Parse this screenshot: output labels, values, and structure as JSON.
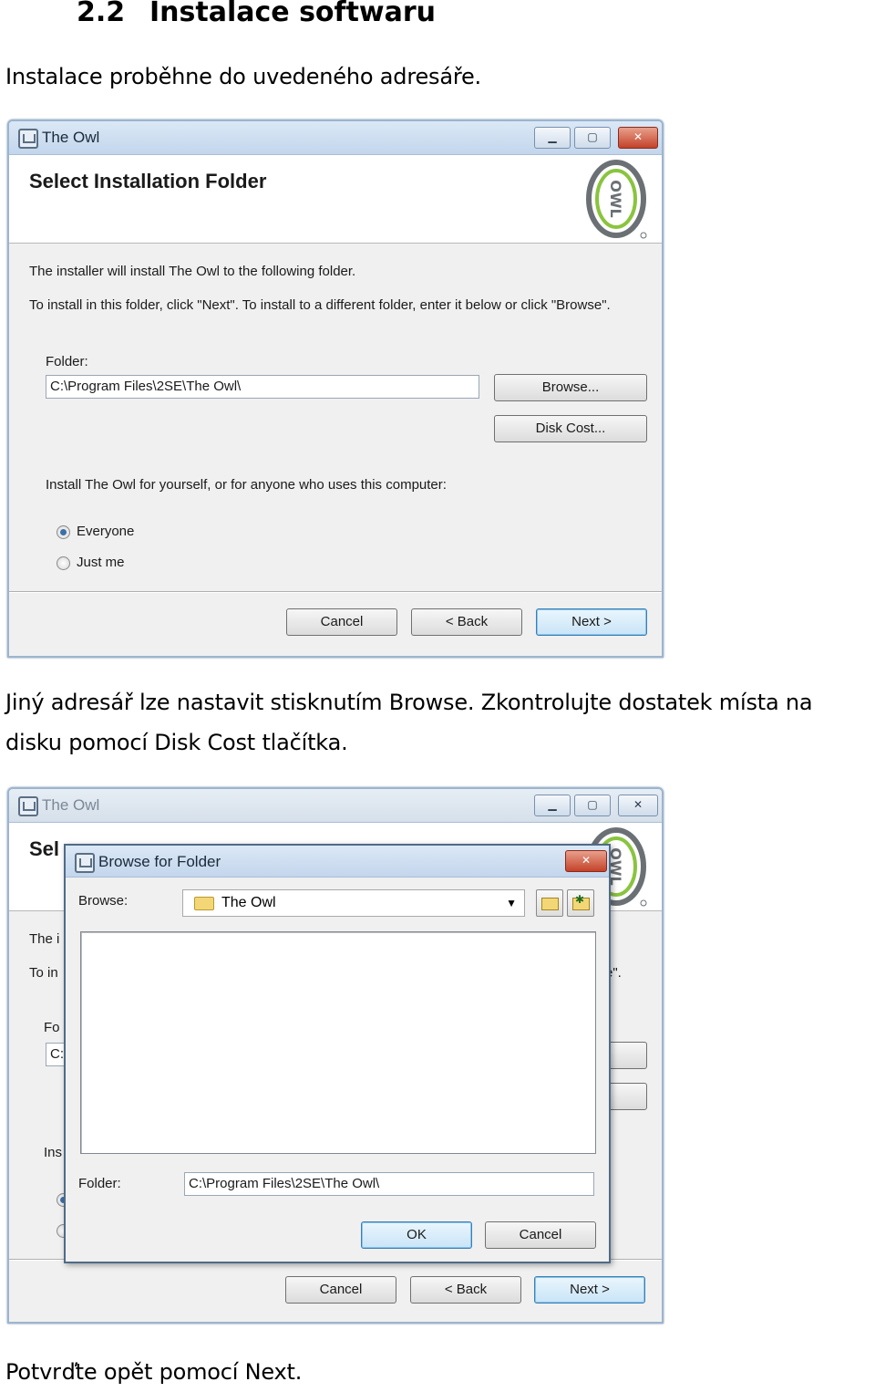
{
  "doc": {
    "heading_number": "2.2",
    "heading_text": "Instalace softwaru",
    "para1": "Instalace proběhne do uvedeného adresáře.",
    "para2_line1": "Jiný adresář lze nastavit stisknutím Browse. Zkontrolujte dostatek místa na",
    "para2_line2": "disku pomocí Disk Cost tlačítka.",
    "para3": "Potvrďte opět pomocí Next."
  },
  "installer": {
    "window_title": "The Owl",
    "banner_title": "Select Installation Folder",
    "logo_text": "OWL",
    "intro_line1": "The installer will install The Owl to the following folder.",
    "intro_line2": "To install in this folder, click \"Next\". To install to a different folder, enter it below or click \"Browse\".",
    "folder_label": "Folder:",
    "folder_value": "C:\\Program Files\\2SE\\The Owl\\",
    "browse_button": "Browse...",
    "disk_cost_button": "Disk Cost...",
    "scope_label": "Install The Owl for yourself, or for anyone who uses this computer:",
    "option_everyone": "Everyone",
    "option_just_me": "Just me",
    "selected_option": "Everyone",
    "cancel_button": "Cancel",
    "back_button": "< Back",
    "next_button": "Next >"
  },
  "installer_partial": {
    "banner_fragment": "Sel",
    "intro_fragment1": "The i",
    "intro_fragment2": "To in",
    "intro_tail2": "e\".",
    "folder_label_fragment": "Fo",
    "folder_value_fragment": "C:",
    "scope_fragment": "Ins"
  },
  "browse_dialog": {
    "title": "Browse for Folder",
    "browse_label": "Browse:",
    "browse_value": "The Owl",
    "folder_label": "Folder:",
    "folder_value": "C:\\Program Files\\2SE\\The Owl\\",
    "ok_button": "OK",
    "cancel_button": "Cancel"
  },
  "icons": {
    "app": "installer-app-icon",
    "logo": "owl-logo",
    "up_folder": "up-one-level-icon",
    "new_folder": "new-folder-icon",
    "folder": "folder-icon"
  }
}
